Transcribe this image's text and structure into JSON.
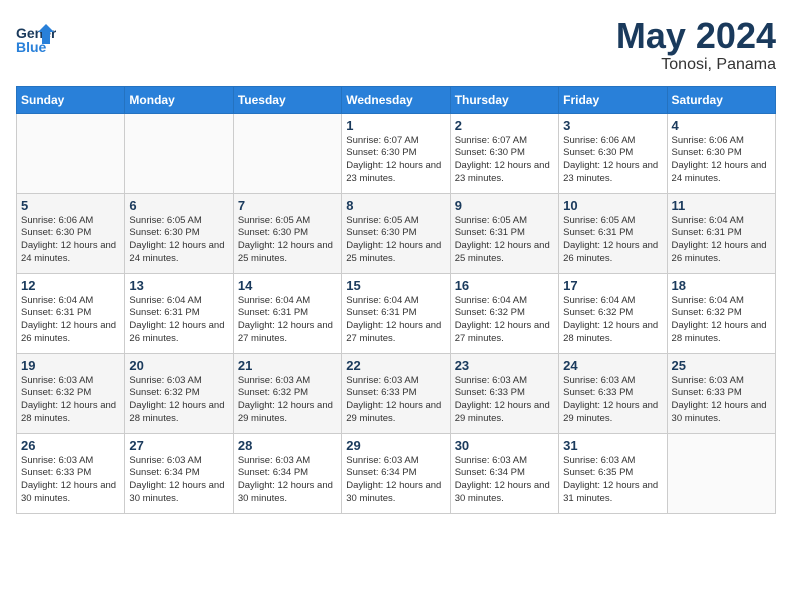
{
  "header": {
    "logo_general": "General",
    "logo_blue": "Blue",
    "month": "May 2024",
    "location": "Tonosi, Panama"
  },
  "weekdays": [
    "Sunday",
    "Monday",
    "Tuesday",
    "Wednesday",
    "Thursday",
    "Friday",
    "Saturday"
  ],
  "weeks": [
    [
      {
        "day": "",
        "sunrise": "",
        "sunset": "",
        "daylight": ""
      },
      {
        "day": "",
        "sunrise": "",
        "sunset": "",
        "daylight": ""
      },
      {
        "day": "",
        "sunrise": "",
        "sunset": "",
        "daylight": ""
      },
      {
        "day": "1",
        "sunrise": "6:07 AM",
        "sunset": "6:30 PM",
        "daylight": "12 hours and 23 minutes."
      },
      {
        "day": "2",
        "sunrise": "6:07 AM",
        "sunset": "6:30 PM",
        "daylight": "12 hours and 23 minutes."
      },
      {
        "day": "3",
        "sunrise": "6:06 AM",
        "sunset": "6:30 PM",
        "daylight": "12 hours and 23 minutes."
      },
      {
        "day": "4",
        "sunrise": "6:06 AM",
        "sunset": "6:30 PM",
        "daylight": "12 hours and 24 minutes."
      }
    ],
    [
      {
        "day": "5",
        "sunrise": "6:06 AM",
        "sunset": "6:30 PM",
        "daylight": "12 hours and 24 minutes."
      },
      {
        "day": "6",
        "sunrise": "6:05 AM",
        "sunset": "6:30 PM",
        "daylight": "12 hours and 24 minutes."
      },
      {
        "day": "7",
        "sunrise": "6:05 AM",
        "sunset": "6:30 PM",
        "daylight": "12 hours and 25 minutes."
      },
      {
        "day": "8",
        "sunrise": "6:05 AM",
        "sunset": "6:30 PM",
        "daylight": "12 hours and 25 minutes."
      },
      {
        "day": "9",
        "sunrise": "6:05 AM",
        "sunset": "6:31 PM",
        "daylight": "12 hours and 25 minutes."
      },
      {
        "day": "10",
        "sunrise": "6:05 AM",
        "sunset": "6:31 PM",
        "daylight": "12 hours and 26 minutes."
      },
      {
        "day": "11",
        "sunrise": "6:04 AM",
        "sunset": "6:31 PM",
        "daylight": "12 hours and 26 minutes."
      }
    ],
    [
      {
        "day": "12",
        "sunrise": "6:04 AM",
        "sunset": "6:31 PM",
        "daylight": "12 hours and 26 minutes."
      },
      {
        "day": "13",
        "sunrise": "6:04 AM",
        "sunset": "6:31 PM",
        "daylight": "12 hours and 26 minutes."
      },
      {
        "day": "14",
        "sunrise": "6:04 AM",
        "sunset": "6:31 PM",
        "daylight": "12 hours and 27 minutes."
      },
      {
        "day": "15",
        "sunrise": "6:04 AM",
        "sunset": "6:31 PM",
        "daylight": "12 hours and 27 minutes."
      },
      {
        "day": "16",
        "sunrise": "6:04 AM",
        "sunset": "6:32 PM",
        "daylight": "12 hours and 27 minutes."
      },
      {
        "day": "17",
        "sunrise": "6:04 AM",
        "sunset": "6:32 PM",
        "daylight": "12 hours and 28 minutes."
      },
      {
        "day": "18",
        "sunrise": "6:04 AM",
        "sunset": "6:32 PM",
        "daylight": "12 hours and 28 minutes."
      }
    ],
    [
      {
        "day": "19",
        "sunrise": "6:03 AM",
        "sunset": "6:32 PM",
        "daylight": "12 hours and 28 minutes."
      },
      {
        "day": "20",
        "sunrise": "6:03 AM",
        "sunset": "6:32 PM",
        "daylight": "12 hours and 28 minutes."
      },
      {
        "day": "21",
        "sunrise": "6:03 AM",
        "sunset": "6:32 PM",
        "daylight": "12 hours and 29 minutes."
      },
      {
        "day": "22",
        "sunrise": "6:03 AM",
        "sunset": "6:33 PM",
        "daylight": "12 hours and 29 minutes."
      },
      {
        "day": "23",
        "sunrise": "6:03 AM",
        "sunset": "6:33 PM",
        "daylight": "12 hours and 29 minutes."
      },
      {
        "day": "24",
        "sunrise": "6:03 AM",
        "sunset": "6:33 PM",
        "daylight": "12 hours and 29 minutes."
      },
      {
        "day": "25",
        "sunrise": "6:03 AM",
        "sunset": "6:33 PM",
        "daylight": "12 hours and 30 minutes."
      }
    ],
    [
      {
        "day": "26",
        "sunrise": "6:03 AM",
        "sunset": "6:33 PM",
        "daylight": "12 hours and 30 minutes."
      },
      {
        "day": "27",
        "sunrise": "6:03 AM",
        "sunset": "6:34 PM",
        "daylight": "12 hours and 30 minutes."
      },
      {
        "day": "28",
        "sunrise": "6:03 AM",
        "sunset": "6:34 PM",
        "daylight": "12 hours and 30 minutes."
      },
      {
        "day": "29",
        "sunrise": "6:03 AM",
        "sunset": "6:34 PM",
        "daylight": "12 hours and 30 minutes."
      },
      {
        "day": "30",
        "sunrise": "6:03 AM",
        "sunset": "6:34 PM",
        "daylight": "12 hours and 30 minutes."
      },
      {
        "day": "31",
        "sunrise": "6:03 AM",
        "sunset": "6:35 PM",
        "daylight": "12 hours and 31 minutes."
      },
      {
        "day": "",
        "sunrise": "",
        "sunset": "",
        "daylight": ""
      }
    ]
  ]
}
